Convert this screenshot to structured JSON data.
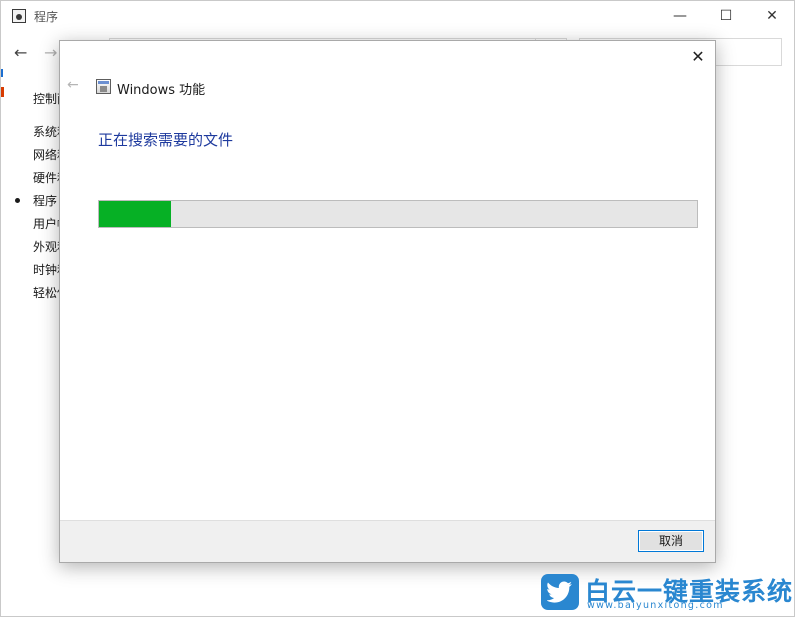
{
  "background_window": {
    "title": "程序",
    "controls": {
      "minimize": "—",
      "maximize": "☐",
      "close": "✕"
    },
    "nav": {
      "back": "←",
      "forward": "→"
    },
    "sidebar": {
      "items": [
        {
          "label": "控制面"
        },
        {
          "label": "系统和"
        },
        {
          "label": "网络和"
        },
        {
          "label": "硬件和"
        },
        {
          "label": "程序",
          "selected": true
        },
        {
          "label": "用户帐"
        },
        {
          "label": "外观和"
        },
        {
          "label": "时钟和"
        },
        {
          "label": "轻松使"
        }
      ]
    }
  },
  "dialog": {
    "title": "Windows 功能",
    "close_glyph": "✕",
    "back_glyph": "←",
    "heading": "正在搜索需要的文件",
    "progress": {
      "fraction": 0.12,
      "color": "#06b025"
    },
    "cancel_label": "取消",
    "icon": "windows-features-icon"
  },
  "watermark": {
    "text": "白云一键重装系统",
    "url": "www.baiyunxitong.com",
    "color": "#2a87d0",
    "icon": "bird-logo-icon"
  }
}
